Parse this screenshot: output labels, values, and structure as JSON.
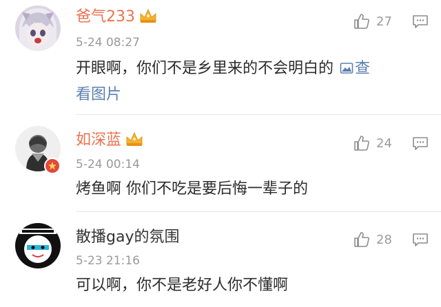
{
  "comments": [
    {
      "username": "爸气233",
      "timestamp": "5-24 08:27",
      "text": "开眼啊，你们不是乡里来的不会明白的",
      "link_text_1": "查",
      "link_text_2": "看图片",
      "likes": "27",
      "username_color": "#eb7350"
    },
    {
      "username": "如深蓝",
      "timestamp": "5-24 00:14",
      "text": "烤鱼啊  你们不吃是要后悔一辈子的",
      "likes": "24",
      "username_color": "#eb7350"
    },
    {
      "username": "散播gay的氛围",
      "timestamp": "5-23 21:16",
      "text": "可以啊，你不是老好人你不懂啊",
      "likes": "28",
      "username_color": "#333333"
    }
  ],
  "colors": {
    "accent_orange": "#eb7350",
    "link_blue": "#5b7fb0",
    "meta_gray": "#9a9a9a"
  },
  "icons": {
    "like": "thumbs-up-icon",
    "reply": "comment-bubble-icon",
    "crown": "crown-icon",
    "picture": "picture-icon"
  }
}
